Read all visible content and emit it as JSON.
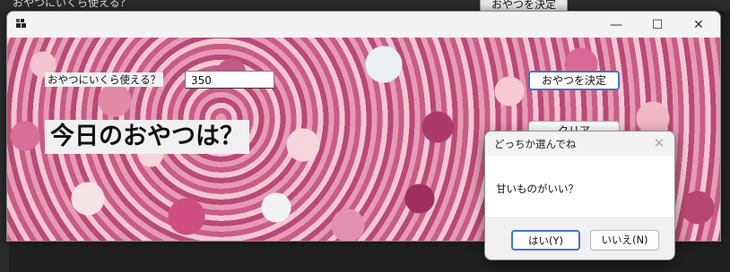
{
  "background_window": {
    "label_text": "おやつにいくら使える？",
    "button_text": "おやつを決定"
  },
  "window": {
    "title": "",
    "controls": {
      "minimize": "—",
      "maximize": "☐",
      "close": "✕"
    }
  },
  "form": {
    "budget_label": "おやつにいくら使える？",
    "budget_value": "350",
    "decide_button": "おやつを決定",
    "clear_button": "クリア",
    "result_label": "今日のおやつは？"
  },
  "dialog": {
    "title": "どっちか選んでね",
    "message": "甘いものがいい？",
    "yes_button": "はい(Y)",
    "no_button": "いいえ(N)",
    "close_glyph": "✕"
  },
  "colors": {
    "accent": "#3f76c4",
    "window_bg": "#f3f3f3",
    "dialog_footer": "#f0f0f0"
  }
}
